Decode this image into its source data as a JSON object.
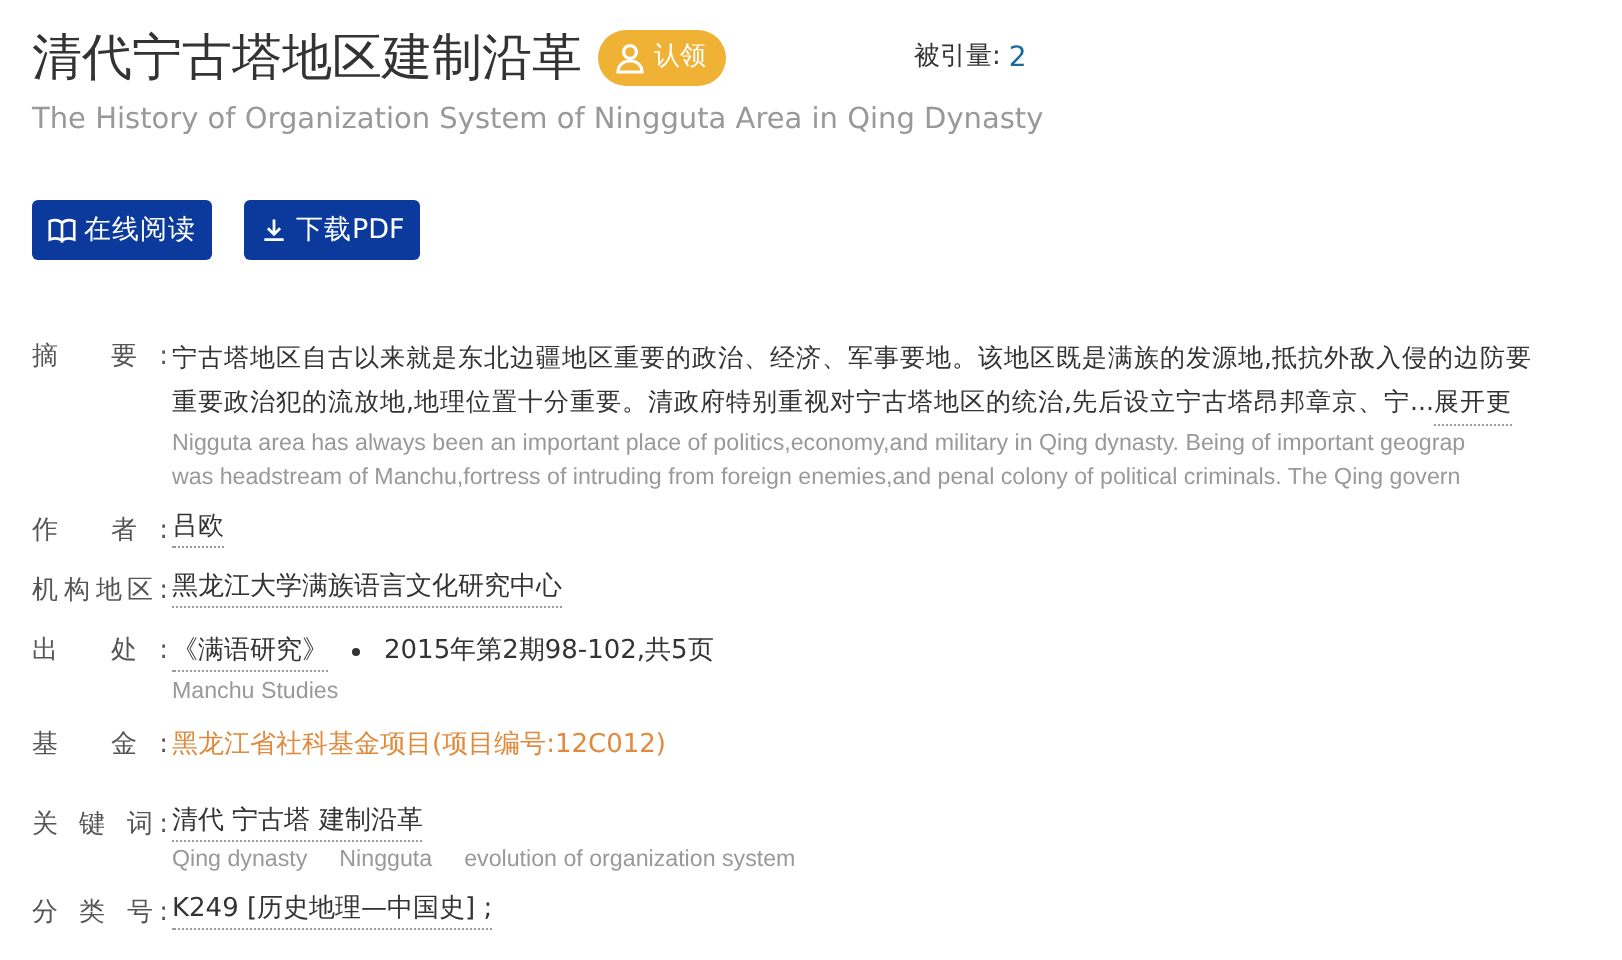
{
  "title": "清代宁古塔地区建制沿革",
  "claim_button": "认领",
  "citations": {
    "label": "被引量:",
    "value": "2"
  },
  "subtitle": "The History of Organization System of Ningguta Area in Qing Dynasty",
  "buttons": [
    {
      "kind": "read",
      "label": "在线阅读"
    },
    {
      "kind": "download",
      "label": "下载PDF"
    }
  ],
  "fields": [
    {
      "kind": "abstract",
      "label": "摘 要:",
      "lines": [
        "宁古塔地区自古以来就是东北边疆地区重要的政治、经济、军事要地。该地区既是满族的发源地,抵抗外敌入侵的边防要",
        "重要政治犯的流放地,地理位置十分重要。清政府特别重视对宁古塔地区的统治,先后设立宁古塔昂邦章京、宁..."
      ],
      "more": "展开更",
      "en_lines": [
        "Nigguta area has always been an important place of politics,economy,and military in Qing dynasty. Being of important geograp",
        "was headstream of Manchu,fortress of intruding from foreign enemies,and penal colony of political criminals. The Qing govern"
      ]
    },
    {
      "kind": "link",
      "label": "作 者:",
      "value": "吕欧"
    },
    {
      "kind": "link",
      "label": "机构地区:",
      "value": "黑龙江大学满族语言文化研究中心"
    },
    {
      "kind": "source",
      "label": "出 处:",
      "value": "《满语研究》",
      "detail": "2015年第2期98-102,共5页",
      "en": "Manchu Studies"
    },
    {
      "kind": "fund",
      "label": "基 金:",
      "value": "黑龙江省社科基金项目(项目编号:12C012)"
    },
    {
      "kind": "keywords",
      "label": "关 键 词:",
      "value": "清代 宁古塔 建制沿革",
      "en_words": [
        "Qing dynasty",
        "Ningguta",
        "evolution of organization system"
      ]
    },
    {
      "kind": "link",
      "label": "分 类 号:",
      "value": "K249 [历史地理—中国史] ;"
    }
  ]
}
